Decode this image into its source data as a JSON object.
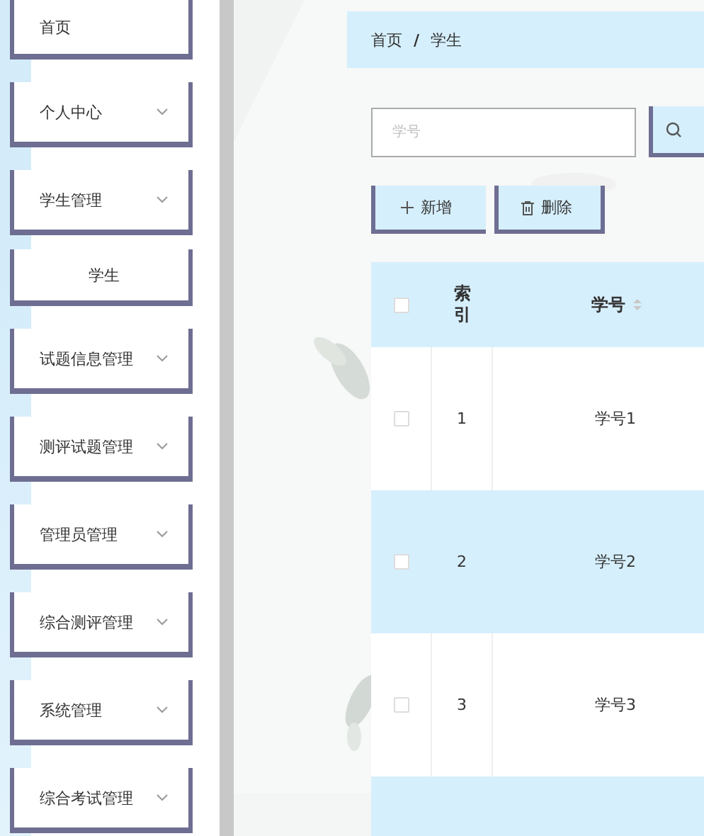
{
  "sidebar": {
    "items": [
      {
        "label": "首页",
        "kind": "link"
      },
      {
        "label": "个人中心",
        "kind": "menu"
      },
      {
        "label": "学生管理",
        "kind": "menu",
        "children": [
          {
            "label": "学生"
          }
        ]
      },
      {
        "label": "试题信息管理",
        "kind": "menu"
      },
      {
        "label": "测评试题管理",
        "kind": "menu"
      },
      {
        "label": "管理员管理",
        "kind": "menu"
      },
      {
        "label": "综合测评管理",
        "kind": "menu"
      },
      {
        "label": "系统管理",
        "kind": "menu"
      },
      {
        "label": "综合考试管理",
        "kind": "menu"
      }
    ]
  },
  "breadcrumb": {
    "items": [
      "首页",
      "学生"
    ],
    "separator": "/"
  },
  "search": {
    "placeholder": "学号"
  },
  "buttons": [
    {
      "label": "新增",
      "kind": "add"
    },
    {
      "label": "删除",
      "kind": "delete"
    }
  ],
  "table": {
    "all_checked": false,
    "columns": [
      {
        "label": "索引",
        "sortable": false
      },
      {
        "label": "学号",
        "sortable": true
      }
    ],
    "rows": [
      {
        "index": "1",
        "student_id": "学号1",
        "checked": false
      },
      {
        "index": "2",
        "student_id": "学号2",
        "checked": false
      },
      {
        "index": "3",
        "student_id": "学号3",
        "checked": false
      }
    ]
  }
}
